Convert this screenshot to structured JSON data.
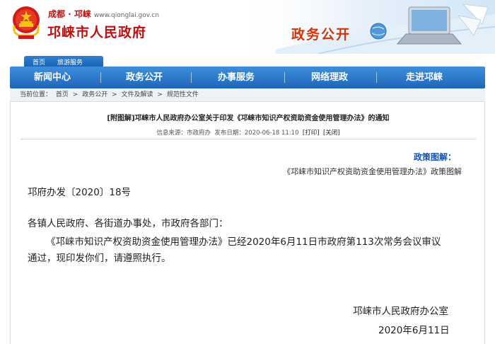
{
  "header": {
    "city_label": "成都 · 邛崃",
    "url": "www.qionglai.gov.cn",
    "site_title": "邛崃市人民政府",
    "banner_text": "政务公开"
  },
  "subtabs": [
    "首页",
    "旅游服务"
  ],
  "nav": [
    "新闻中心",
    "政务公开",
    "办事服务",
    "网络理政",
    "走进邛崃"
  ],
  "breadcrumb": [
    "当前位置：",
    "首页",
    ">",
    "政务公开",
    ">",
    "文件及解读",
    ">",
    "规范性文件"
  ],
  "document": {
    "title": "[附图解]邛崃市人民政府办公室关于印发《邛崃市知识产权资助资金使用管理办法》的通知",
    "meta": {
      "source_label": "信息来源：",
      "source": "市政府办",
      "date_label": "发布日期：",
      "date": "2020-06-18 11:10",
      "print": "[打印]",
      "close": "[关闭]"
    },
    "policy_label": "政策图解：",
    "policy_link": "《邛崃市知识产权资助资金使用管理办法》政策图解",
    "doc_number": "邛府办发〔2020〕18号",
    "recipients": "各镇人民政府、各街道办事处，市政府各部门：",
    "para_line1": "《邛崃市知识产权资助资金使用管理办法》已经2020年6月11日市政府第113次常务会议审议",
    "para_line2": "通过，现印发你们，请遵照执行。",
    "signature_org": "邛崃市人民政府办公室",
    "signature_date": "2020年6月11日"
  },
  "colors": {
    "title_red": "#c00d0d",
    "nav_blue": "#1f65b8",
    "policy_blue": "#1652b0"
  }
}
